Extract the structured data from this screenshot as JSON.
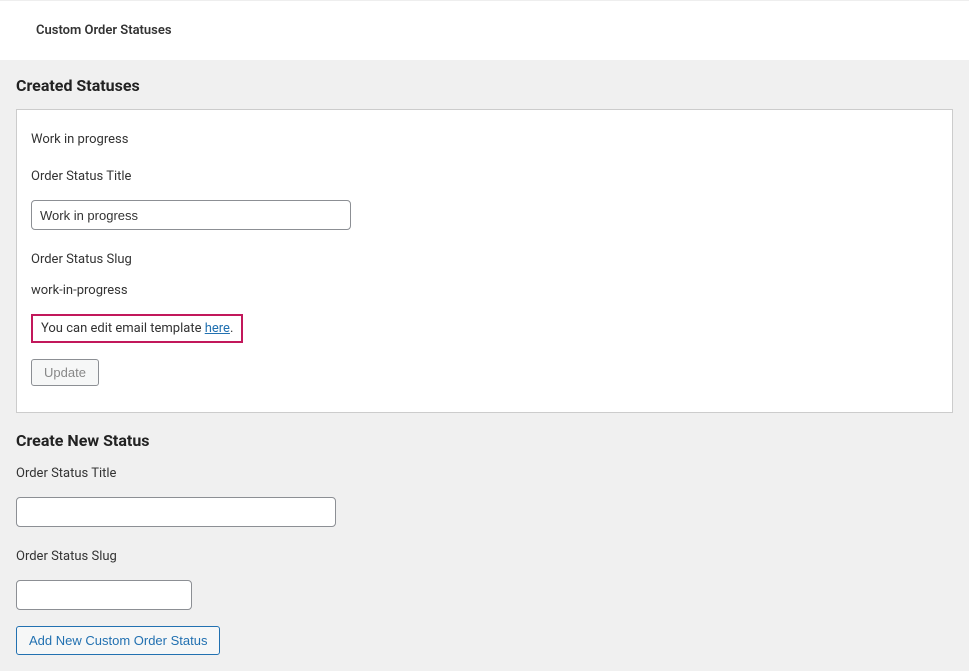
{
  "top_bar": {
    "title": "Custom Order Statuses"
  },
  "created_statuses": {
    "heading": "Created Statuses",
    "status_name": "Work in progress",
    "title_label": "Order Status Title",
    "title_value": "Work in progress",
    "slug_label": "Order Status Slug",
    "slug_value": "work-in-progress",
    "template_note_prefix": "You can edit email template ",
    "template_note_link": "here",
    "template_note_suffix": ".",
    "update_button": "Update"
  },
  "create_new": {
    "heading": "Create New Status",
    "title_label": "Order Status Title",
    "title_value": "",
    "slug_label": "Order Status Slug",
    "slug_value": "",
    "add_button": "Add New Custom Order Status"
  }
}
